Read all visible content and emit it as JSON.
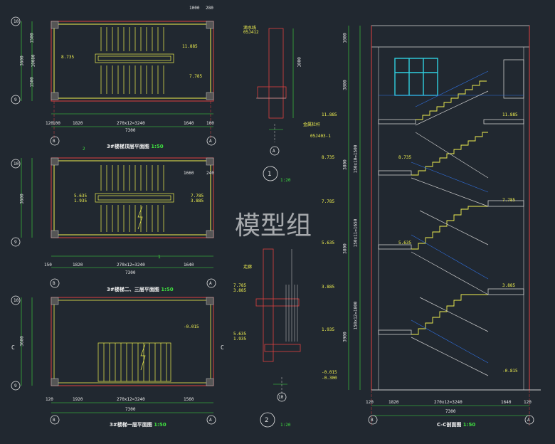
{
  "watermark": "模型组",
  "plans": [
    {
      "title": "3#楼梯顶层平面图",
      "scale": "1:50",
      "level_a": "8.735",
      "level_b": "11.885",
      "level_c": "7.785",
      "dims_bottom": [
        "120",
        "100",
        "1820",
        "270x12=3240",
        "1640",
        "100",
        "120"
      ],
      "dims_total": "7300",
      "dims_top": [
        "1000",
        "280"
      ],
      "dims_left": [
        "120",
        "1320",
        "1500",
        "10080",
        "1500",
        "120"
      ],
      "left_total": "3600",
      "axis_left_top": "10",
      "axis_left_bottom": "9",
      "axis_bottom_left": "B",
      "axis_bottom_right": "A"
    },
    {
      "title": "3#楼梯二、三层平面图",
      "scale": "1:50",
      "level_a": "5.635",
      "level_a2": "1.935",
      "level_c": "7.785",
      "level_c2": "3.885",
      "dims_bottom": [
        "150",
        "100",
        "1820",
        "270x12=3240",
        "1640",
        "100",
        "120"
      ],
      "dims_total": "7300",
      "dims_top": [
        "1660",
        "240"
      ],
      "dims_left": [
        "120",
        "1320",
        "1500",
        "10080",
        "1500",
        "120"
      ],
      "left_total": "3600",
      "axis_left_top": "10",
      "axis_left_bottom": "9",
      "axis_bottom_left": "B",
      "axis_bottom_right": "A",
      "callout_top": "2",
      "callout_bottom": "1"
    },
    {
      "title": "3#楼梯一层平面图",
      "scale": "1:50",
      "level": "-0.015",
      "side_label": "C",
      "dims_bottom": [
        "120",
        "1920",
        "270x12=3240",
        "1560",
        "120"
      ],
      "dims_total": "7300",
      "dims_left": [
        "1500",
        "3600",
        "1920",
        "120"
      ],
      "axis_left_top": "10",
      "axis_left_bottom": "9",
      "axis_bottom_left": "B",
      "axis_bottom_right": "A"
    }
  ],
  "details": [
    {
      "callout": "1",
      "scale": "1:20",
      "note1": "滴水线",
      "note2": "05J412",
      "dims": [
        "100",
        "1000"
      ],
      "axis": "A"
    },
    {
      "callout": "2",
      "scale": "1:20",
      "note": "走廊",
      "levels": [
        "7.785",
        "3.885",
        "5.635",
        "1.935"
      ],
      "dims": [
        "120",
        "900",
        "1000"
      ],
      "axis": "10"
    }
  ],
  "section": {
    "title": "C-C剖面图",
    "scale": "1:50",
    "levels": [
      "11.885",
      "8.735",
      "7.785",
      "5.635",
      "3.885",
      "1.935",
      "-0.015",
      "-0.300"
    ],
    "right_levels": [
      "11.885",
      "8.735",
      "7.785",
      "5.635",
      "3.885",
      "-0.815"
    ],
    "left_levels": [
      "11.885",
      "8.735",
      "7.785",
      "5.635",
      "3.885",
      "1.935",
      "-0.015",
      "-0.300"
    ],
    "note_a": "金属栏杆",
    "note_b": "05J403-1",
    "left_dims": [
      "1000",
      "3800",
      "3800",
      "3800",
      "3900"
    ],
    "flight_dims": [
      "150x10=1500",
      "150x11=1650",
      "150x12=1800"
    ],
    "bottom_dims": [
      "120",
      "1820",
      "270x12=3240",
      "1640",
      "120"
    ],
    "total": "7300",
    "axis_left": "B",
    "axis_right": "A",
    "inner_dims": [
      "1000",
      "1100",
      "1000",
      "1200",
      "100"
    ]
  }
}
